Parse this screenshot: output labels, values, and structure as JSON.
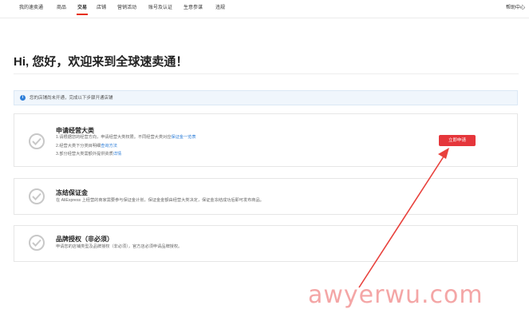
{
  "nav": {
    "items": [
      {
        "label": "我的速卖通",
        "active": false
      },
      {
        "label": "商品",
        "active": false
      },
      {
        "label": "交易",
        "active": true
      },
      {
        "label": "店铺",
        "active": false
      },
      {
        "label": "营销活动",
        "active": false
      },
      {
        "label": "账号及认证",
        "active": false
      },
      {
        "label": "生意参谋",
        "active": false
      },
      {
        "label": "违规",
        "active": false
      }
    ],
    "help": "帮助中心"
  },
  "greeting": "Hi, 您好，欢迎来到全球速卖通！",
  "notice": {
    "icon": "info-icon",
    "text": "您的店铺尚未开通，完成以下步骤开通店铺"
  },
  "steps": [
    {
      "title": "申请经营大类",
      "lines": [
        {
          "text": "1.请根据您的经营方向，申请经营大类权限。不同经营大类对应",
          "link": "保证金一览表"
        },
        {
          "text": "2.经营大类下分类目明细",
          "link": "查询方法"
        },
        {
          "text": "3.部分经营大类需额外提供资质",
          "link": "详情"
        }
      ],
      "button": "立即申请"
    },
    {
      "title": "冻结保证金",
      "lines": [
        {
          "text": "在 AliExpress 上经营的商家需要参与保证金计划，保证金金额由经营大类决定，保证金冻结成功后即可发布商品。",
          "link": ""
        }
      ]
    },
    {
      "title": "品牌授权（非必须）",
      "lines": [
        {
          "text": "申请您的店铺类型及品牌授权（非必须），官方店必须申请品牌授权。",
          "link": ""
        }
      ]
    }
  ],
  "watermark": "awyerwu.com",
  "colors": {
    "accent": "#e62e04",
    "button": "#e5363b",
    "link": "#2f7fd8",
    "arrow": "#e8413c"
  }
}
